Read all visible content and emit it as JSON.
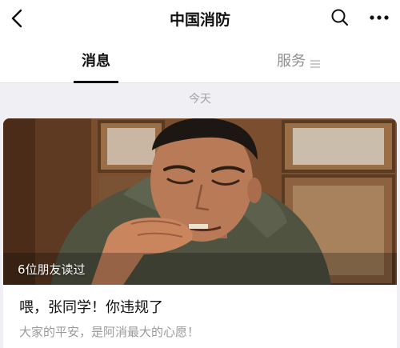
{
  "header": {
    "title": "中国消防",
    "icons": {
      "back": "chevron-left-icon",
      "search": "search-icon",
      "more": "more-dots-icon"
    }
  },
  "tabs": {
    "messages": "消息",
    "services": "服务",
    "services_icon": "menu-lines-icon"
  },
  "feed": {
    "date_label": "今天",
    "card": {
      "read_count": "6位朋友读过",
      "headline": "喂，张同学！你违规了",
      "summary": "大家的平安，是阿消最大的心愿！",
      "image": "cover-photo"
    }
  },
  "colors": {
    "background": "#efeff4",
    "text_primary": "#111111",
    "text_secondary": "#9a9a9a",
    "tab_inactive": "#8e8e8e"
  }
}
